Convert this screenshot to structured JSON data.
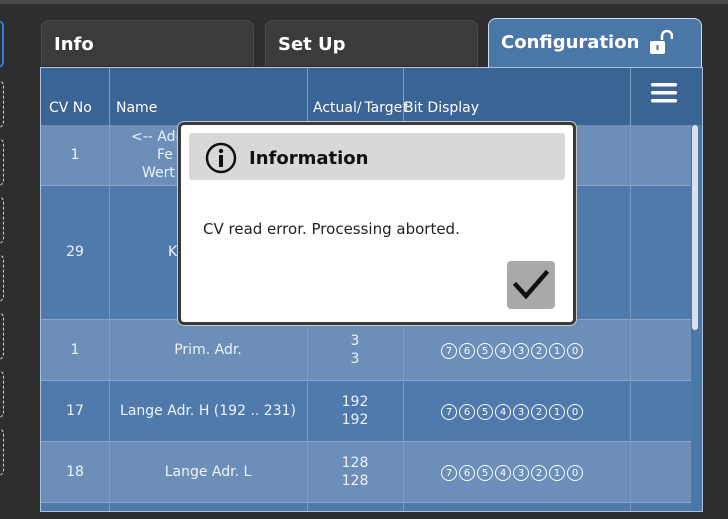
{
  "tabs": [
    {
      "label": "Info"
    },
    {
      "label": "Set Up"
    },
    {
      "label": "Configuration"
    }
  ],
  "table": {
    "headers": {
      "cv": "CV No",
      "name": "Name",
      "value": "Actual/ Target",
      "bits": "Bit Display"
    },
    "rows": [
      {
        "cv": "1",
        "name": "<-- Adr",
        "name2": "Fe",
        "name3": "Wert"
      },
      {
        "cv": "29",
        "name": "K"
      },
      {
        "cv": "1",
        "name": "Prim. Adr.",
        "actual": "3",
        "target": "3"
      },
      {
        "cv": "17",
        "name": "Lange Adr. H (192 .. 231)",
        "actual": "192",
        "target": "192"
      },
      {
        "cv": "18",
        "name": "Lange Adr. L",
        "actual": "128",
        "target": "128"
      }
    ],
    "bit_labels": [
      "7",
      "6",
      "5",
      "4",
      "3",
      "2",
      "1",
      "0"
    ]
  },
  "dialog": {
    "title": "Information",
    "message": "CV read error. Processing aborted."
  },
  "icons": {
    "lock": "unlock-icon",
    "menu": "hamburger-menu-icon",
    "info": "info-icon",
    "ok": "checkmark-icon"
  },
  "colors": {
    "panel": "#4a76a8",
    "header": "#3a6494",
    "dialog_header": "#d8d8d8"
  }
}
